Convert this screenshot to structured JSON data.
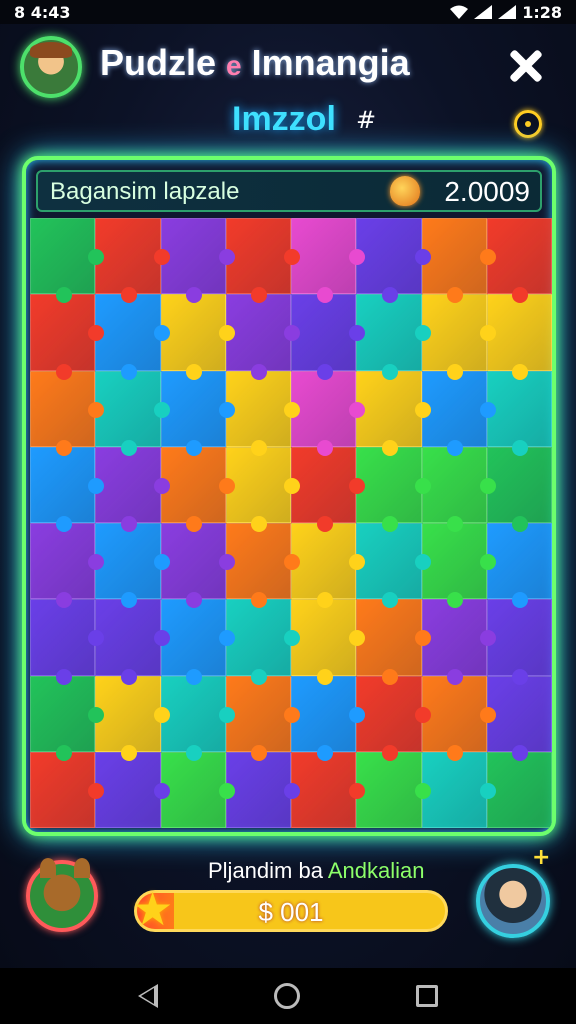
{
  "status_bar": {
    "left_text": "8 4:43",
    "time": "1:28"
  },
  "header": {
    "title_part1": "Pudzle ",
    "title_accent": "e",
    "title_part2": " Imnangia",
    "subtitle": "Imzzol",
    "subtitle_symbol": "#"
  },
  "board": {
    "score_label": "Bagansim lapzale",
    "score_value": "2.0009",
    "colors": [
      "#22c35a",
      "#8a3de0",
      "#f23b2a",
      "#ffd21a",
      "#1e9bff",
      "#ff7a1a",
      "#18d0c0",
      "#6a3fe8",
      "#e84ad0",
      "#38e04a"
    ],
    "rows": 8,
    "cols": 8,
    "pieces": [
      [
        0,
        2,
        1,
        2,
        8,
        7,
        5,
        2
      ],
      [
        2,
        4,
        3,
        1,
        7,
        6,
        3,
        3
      ],
      [
        5,
        6,
        4,
        3,
        8,
        3,
        4,
        6
      ],
      [
        4,
        1,
        5,
        3,
        2,
        9,
        9,
        0
      ],
      [
        1,
        4,
        1,
        5,
        3,
        6,
        9,
        4
      ],
      [
        7,
        7,
        4,
        6,
        3,
        5,
        1,
        7
      ],
      [
        0,
        3,
        6,
        5,
        4,
        2,
        5,
        7
      ],
      [
        2,
        7,
        9,
        7,
        2,
        9,
        6,
        0
      ]
    ]
  },
  "bottom": {
    "player_first": "Pljandim ba",
    "player_second": "Andkalian",
    "progress_text": "$ 001",
    "progress_fraction": 0.12
  },
  "icons": {
    "close": "close-icon",
    "coin": "coin-icon",
    "bag": "bag-icon",
    "star": "star-icon",
    "plus": "plus-icon"
  }
}
